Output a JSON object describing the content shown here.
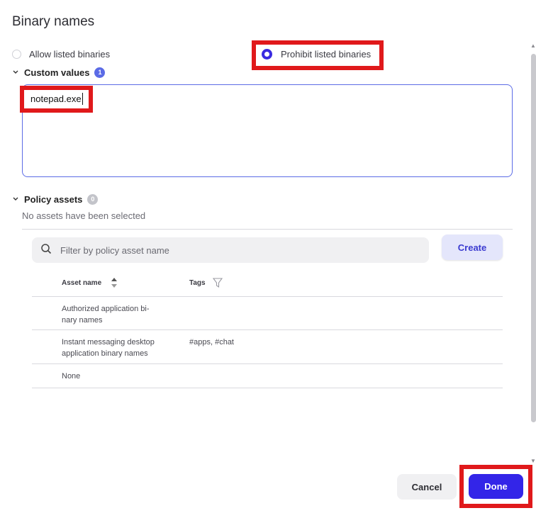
{
  "dialog": {
    "title": "Binary names"
  },
  "mode": {
    "options": [
      {
        "label": "Allow listed binaries",
        "selected": false
      },
      {
        "label": "Prohibit listed binaries",
        "selected": true
      }
    ]
  },
  "custom_values": {
    "label": "Custom values",
    "count": "1",
    "count_color": "#5b6be6",
    "value": "notepad.exe"
  },
  "policy_assets": {
    "label": "Policy assets",
    "count": "0",
    "count_color": "#c3c4ca",
    "empty_text": "No assets have been selected",
    "search_placeholder": "Filter by policy asset name",
    "create_label": "Create",
    "columns": {
      "name": "Asset name",
      "tags": "Tags"
    },
    "rows": [
      {
        "name_line1": "Authorized application bi-",
        "name_line2": "nary names",
        "tags": ""
      },
      {
        "name_line1": "Instant messaging desktop",
        "name_line2": "application binary names",
        "tags": "#apps, #chat"
      },
      {
        "name_line1": "None",
        "name_line2": "",
        "tags": ""
      }
    ]
  },
  "footer": {
    "cancel_label": "Cancel",
    "done_label": "Done"
  },
  "icons": {
    "chevron": "chevron-down-icon",
    "search": "search-icon",
    "sort": "sort-icon",
    "filter": "filter-icon"
  },
  "colors": {
    "accent": "#3325e8",
    "highlight": "#e0191b"
  }
}
